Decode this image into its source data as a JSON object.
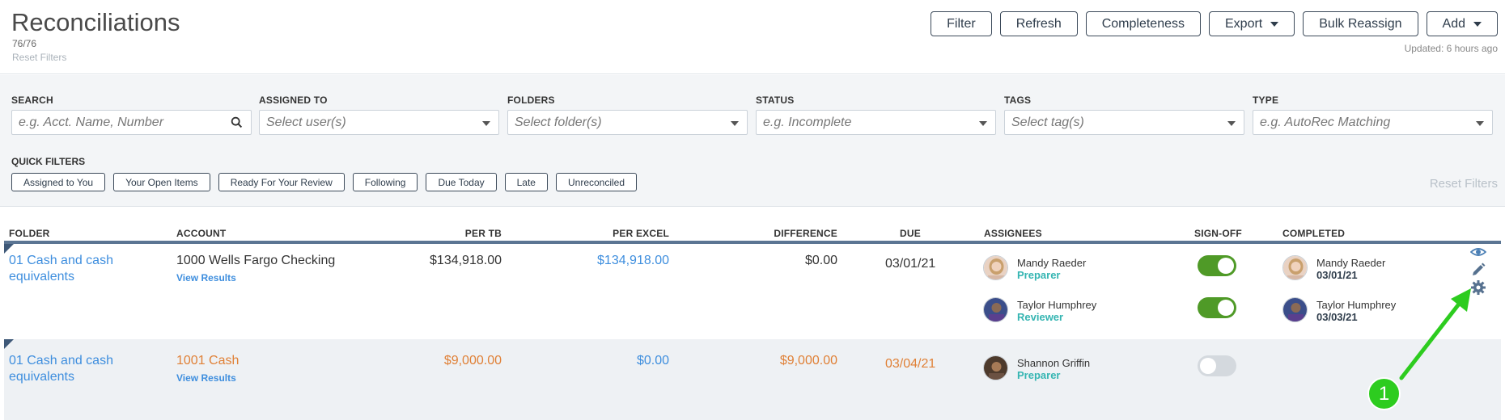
{
  "header": {
    "title": "Reconciliations",
    "count": "76/76",
    "reset_filters": "Reset Filters",
    "updated": "Updated: 6 hours ago",
    "actions": {
      "filter": "Filter",
      "refresh": "Refresh",
      "completeness": "Completeness",
      "export": "Export",
      "bulk_reassign": "Bulk Reassign",
      "add": "Add"
    }
  },
  "filters": {
    "search": {
      "label": "SEARCH",
      "placeholder": "e.g. Acct. Name, Number"
    },
    "assigned_to": {
      "label": "ASSIGNED TO",
      "placeholder": "Select user(s)"
    },
    "folders": {
      "label": "FOLDERS",
      "placeholder": "Select folder(s)"
    },
    "status": {
      "label": "STATUS",
      "placeholder": "e.g. Incomplete"
    },
    "tags": {
      "label": "TAGS",
      "placeholder": "Select tag(s)"
    },
    "type": {
      "label": "TYPE",
      "placeholder": "e.g. AutoRec Matching"
    },
    "quick_filters_label": "QUICK FILTERS",
    "quick_filters": [
      "Assigned to You",
      "Your Open Items",
      "Ready For Your Review",
      "Following",
      "Due Today",
      "Late",
      "Unreconciled"
    ],
    "reset_filters": "Reset Filters"
  },
  "table": {
    "columns": {
      "folder": "FOLDER",
      "account": "ACCOUNT",
      "per_tb": "PER TB",
      "per_excel": "PER EXCEL",
      "difference": "DIFFERENCE",
      "due": "DUE",
      "assignees": "ASSIGNEES",
      "sign_off": "SIGN-OFF",
      "completed": "COMPLETED"
    },
    "rows": [
      {
        "folder_line1": "01 Cash and cash",
        "folder_line2": "equivalents",
        "account": "1000 Wells Fargo Checking",
        "view_results": "View Results",
        "per_tb": "$134,918.00",
        "per_excel": "$134,918.00",
        "difference": "$0.00",
        "due": "03/01/21",
        "assignees": [
          {
            "name": "Mandy Raeder",
            "role": "Preparer",
            "signed": true
          },
          {
            "name": "Taylor Humphrey",
            "role": "Reviewer",
            "signed": true
          }
        ],
        "completed": [
          {
            "name": "Mandy Raeder",
            "date": "03/01/21"
          },
          {
            "name": "Taylor Humphrey",
            "date": "03/03/21"
          }
        ]
      },
      {
        "folder_line1": "01 Cash and cash",
        "folder_line2": "equivalents",
        "account": "1001 Cash",
        "view_results": "View Results",
        "per_tb": "$9,000.00",
        "per_excel": "$0.00",
        "difference": "$9,000.00",
        "due": "03/04/21",
        "assignees": [
          {
            "name": "Shannon Griffin",
            "role": "Preparer",
            "signed": false
          }
        ]
      }
    ]
  },
  "annotation": {
    "badge_number": "1"
  },
  "colors": {
    "link_blue": "#3e8ede",
    "warning_orange": "#e08036",
    "toggle_on": "#4f9a27",
    "role_teal": "#35b5b2",
    "annotation_green": "#2dcc1f"
  }
}
